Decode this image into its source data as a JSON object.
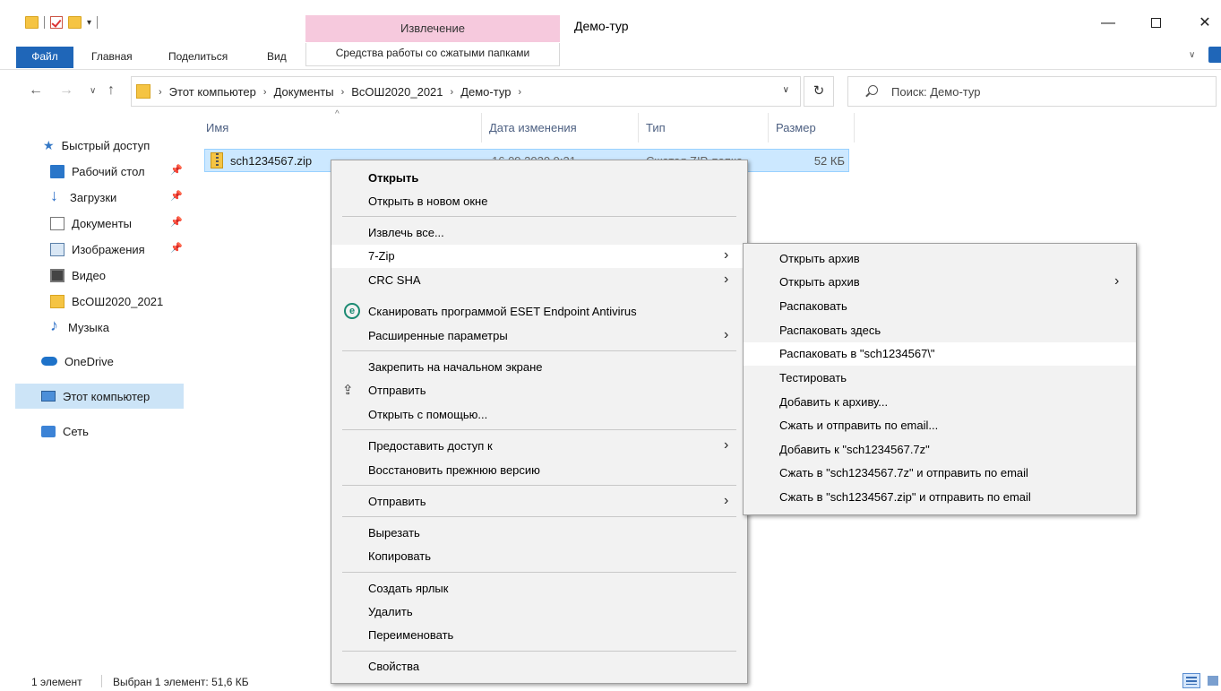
{
  "window": {
    "title": "Демо-тур",
    "context_tab_header": "Извлечение",
    "controls": {
      "minimize": "—",
      "close": "✕"
    }
  },
  "ribbon": {
    "tabs": [
      "Файл",
      "Главная",
      "Поделиться",
      "Вид"
    ],
    "contextual_tab": "Средства работы со сжатыми папками"
  },
  "address": {
    "breadcrumbs": [
      "Этот компьютер",
      "Документы",
      "ВсОШ2020_2021",
      "Демо-тур"
    ],
    "search_placeholder": "Поиск: Демо-тур"
  },
  "nav_pane": {
    "quick_access": "Быстрый доступ",
    "items": [
      {
        "label": "Рабочий стол",
        "pinned": true
      },
      {
        "label": "Загрузки",
        "pinned": true
      },
      {
        "label": "Документы",
        "pinned": true
      },
      {
        "label": "Изображения",
        "pinned": true
      },
      {
        "label": "Видео",
        "pinned": false
      },
      {
        "label": "ВсОШ2020_2021",
        "pinned": false
      },
      {
        "label": "Музыка",
        "pinned": false
      }
    ],
    "onedrive": "OneDrive",
    "this_pc": "Этот компьютер",
    "network": "Сеть"
  },
  "file_list": {
    "columns": [
      "Имя",
      "Дата изменения",
      "Тип",
      "Размер"
    ],
    "rows": [
      {
        "name": "sch1234567.zip",
        "date": "16.09.2020 9:21",
        "type": "Сжатая ZIP-папка",
        "size": "52 КБ"
      }
    ]
  },
  "context_menu": {
    "items": [
      "Открыть",
      "Открыть в новом окне",
      "Извлечь все...",
      "7-Zip",
      "CRC SHA",
      "Сканировать программой ESET Endpoint Antivirus",
      "Расширенные параметры",
      "Закрепить на начальном экране",
      "Отправить",
      "Открыть с помощью...",
      "Предоставить доступ к",
      "Восстановить прежнюю версию",
      "Отправить",
      "Вырезать",
      "Копировать",
      "Создать ярлык",
      "Удалить",
      "Переименовать",
      "Свойства"
    ]
  },
  "submenu_7zip": {
    "items": [
      "Открыть архив",
      "Открыть архив",
      "Распаковать",
      "Распаковать здесь",
      "Распаковать в \"sch1234567\\\"",
      "Тестировать",
      "Добавить к архиву...",
      "Сжать и отправить по email...",
      "Добавить к \"sch1234567.7z\"",
      "Сжать в \"sch1234567.7z\" и отправить по email",
      "Сжать в \"sch1234567.zip\" и отправить по email"
    ]
  },
  "status": {
    "count": "1 элемент",
    "selection": "Выбран 1 элемент: 51,6 КБ"
  }
}
